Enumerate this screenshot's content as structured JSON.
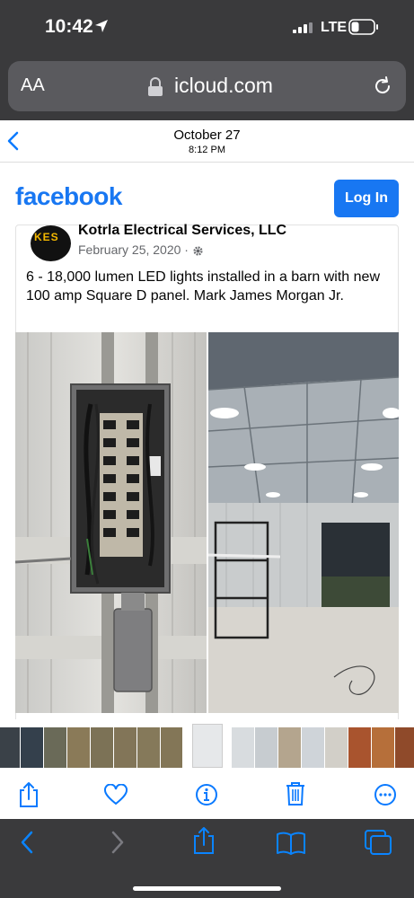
{
  "status_bar": {
    "time": "10:42",
    "network": "LTE"
  },
  "browser": {
    "text_size_label": "AA",
    "url": "icloud.com"
  },
  "photo_viewer": {
    "date": "October 27",
    "time": "8:12 PM"
  },
  "facebook": {
    "logo": "facebook",
    "login_label": "Log In",
    "brand_color": "#1877f2"
  },
  "post": {
    "page_name": "Kotrla Electrical Services, LLC",
    "avatar_text": "KES",
    "date": "February 25, 2020 ·",
    "text": "6 - 18,000 lumen LED lights installed in a barn with new 100 amp Square D panel. Mark James Morgan Jr."
  },
  "icons": {
    "back": "chevron-left-icon",
    "share": "share-icon",
    "favorite": "heart-icon",
    "info": "info-icon",
    "delete": "trash-icon",
    "more": "more-icon",
    "browser_back": "chevron-left-icon",
    "browser_forward": "chevron-right-icon",
    "bookmarks": "book-icon",
    "tabs": "tabs-icon"
  }
}
